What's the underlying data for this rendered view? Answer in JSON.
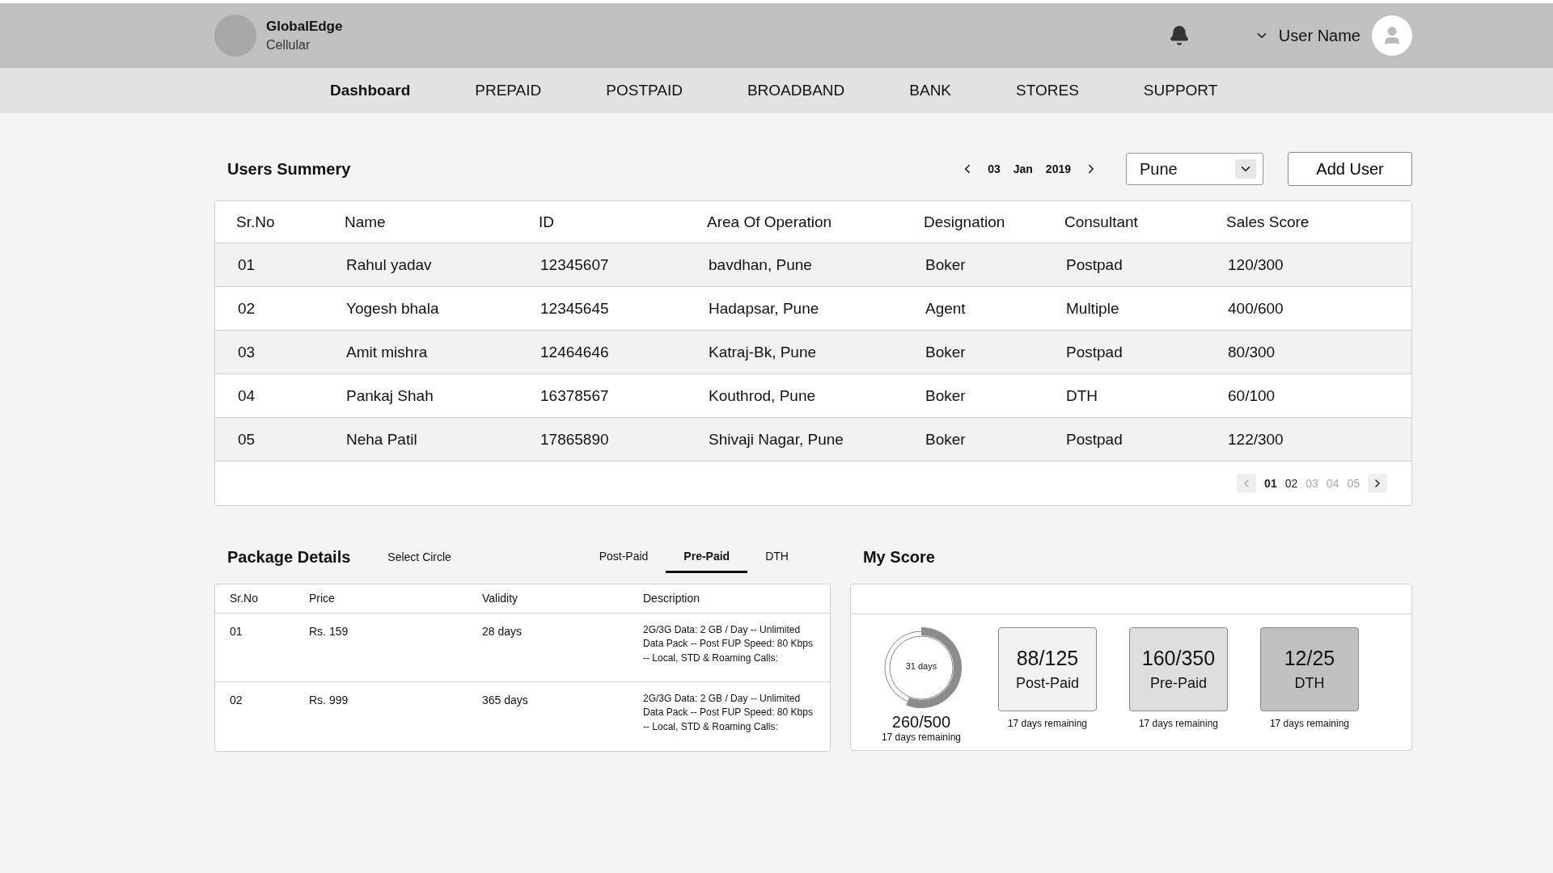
{
  "brand": {
    "name": "GlobalEdge",
    "subtitle": "Cellular"
  },
  "user": {
    "name": "User Name"
  },
  "nav": [
    {
      "label": "Dashboard",
      "selected": true
    },
    {
      "label": "PREPAID",
      "selected": false
    },
    {
      "label": "POSTPAID",
      "selected": false
    },
    {
      "label": "BROADBAND",
      "selected": false
    },
    {
      "label": "BANK",
      "selected": false
    },
    {
      "label": "STORES",
      "selected": false
    },
    {
      "label": "SUPPORT",
      "selected": false
    }
  ],
  "users_summary": {
    "title": "Users Summery",
    "date": {
      "day": "03",
      "month": "Jan",
      "year": "2019"
    },
    "city_select": {
      "value": "Pune"
    },
    "add_button": "Add User",
    "columns": [
      "Sr.No",
      "Name",
      "ID",
      "Area Of Operation",
      "Designation",
      "Consultant",
      "Sales Score"
    ],
    "rows": [
      [
        "01",
        "Rahul yadav",
        "12345607",
        "bavdhan, Pune",
        "Boker",
        "Postpad",
        "120/300"
      ],
      [
        "02",
        "Yogesh bhala",
        "12345645",
        "Hadapsar, Pune",
        "Agent",
        "Multiple",
        "400/600"
      ],
      [
        "03",
        "Amit mishra",
        "12464646",
        "Katraj-Bk, Pune",
        "Boker",
        "Postpad",
        "80/300"
      ],
      [
        "04",
        "Pankaj Shah",
        "16378567",
        "Kouthrod, Pune",
        "Boker",
        "DTH",
        "60/100"
      ],
      [
        "05",
        "Neha Patil",
        "17865890",
        "Shivaji Nagar, Pune",
        "Boker",
        "Postpad",
        "122/300"
      ]
    ],
    "pagination": {
      "prev_disabled": true,
      "pages": [
        {
          "label": "01",
          "selected": true,
          "disabled": false
        },
        {
          "label": "02",
          "selected": false,
          "disabled": false
        },
        {
          "label": "03",
          "selected": false,
          "disabled": true
        },
        {
          "label": "04",
          "selected": false,
          "disabled": true
        },
        {
          "label": "05",
          "selected": false,
          "disabled": true
        }
      ]
    }
  },
  "package_details": {
    "title": "Package Details",
    "circle_label": "Select Circle",
    "tabs": [
      {
        "label": "Post-Paid",
        "selected": false
      },
      {
        "label": "Pre-Paid",
        "selected": true
      },
      {
        "label": "DTH",
        "selected": false
      }
    ],
    "columns": [
      "Sr.No",
      "Price",
      "Validity",
      "Description"
    ],
    "rows": [
      [
        "01",
        "Rs. 159",
        "28 days",
        "2G/3G Data: 2 GB / Day -- Unlimited Data Pack -- Post FUP Speed: 80 Kbps -- Local, STD & Roaming Calls:"
      ],
      [
        "02",
        "Rs. 999",
        "365 days",
        "2G/3G Data: 2 GB / Day -- Unlimited Data Pack -- Post FUP Speed: 80 Kbps -- Local, STD & Roaming Calls:"
      ]
    ]
  },
  "my_score": {
    "title": "My Score",
    "ring": {
      "center": "31 days",
      "level": 0.56,
      "score": "260/500",
      "note": "17 days remaining"
    },
    "cards": [
      {
        "score": "88/125",
        "label": "Post-Paid",
        "note": "17 days remaining",
        "color": "#f2f2f2"
      },
      {
        "score": "160/350",
        "label": "Pre-Paid",
        "note": "17 days remaining",
        "color": "#dedede"
      },
      {
        "score": "12/25",
        "label": "DTH",
        "note": "17 days remaining",
        "color": "#c0c0c0"
      }
    ]
  }
}
